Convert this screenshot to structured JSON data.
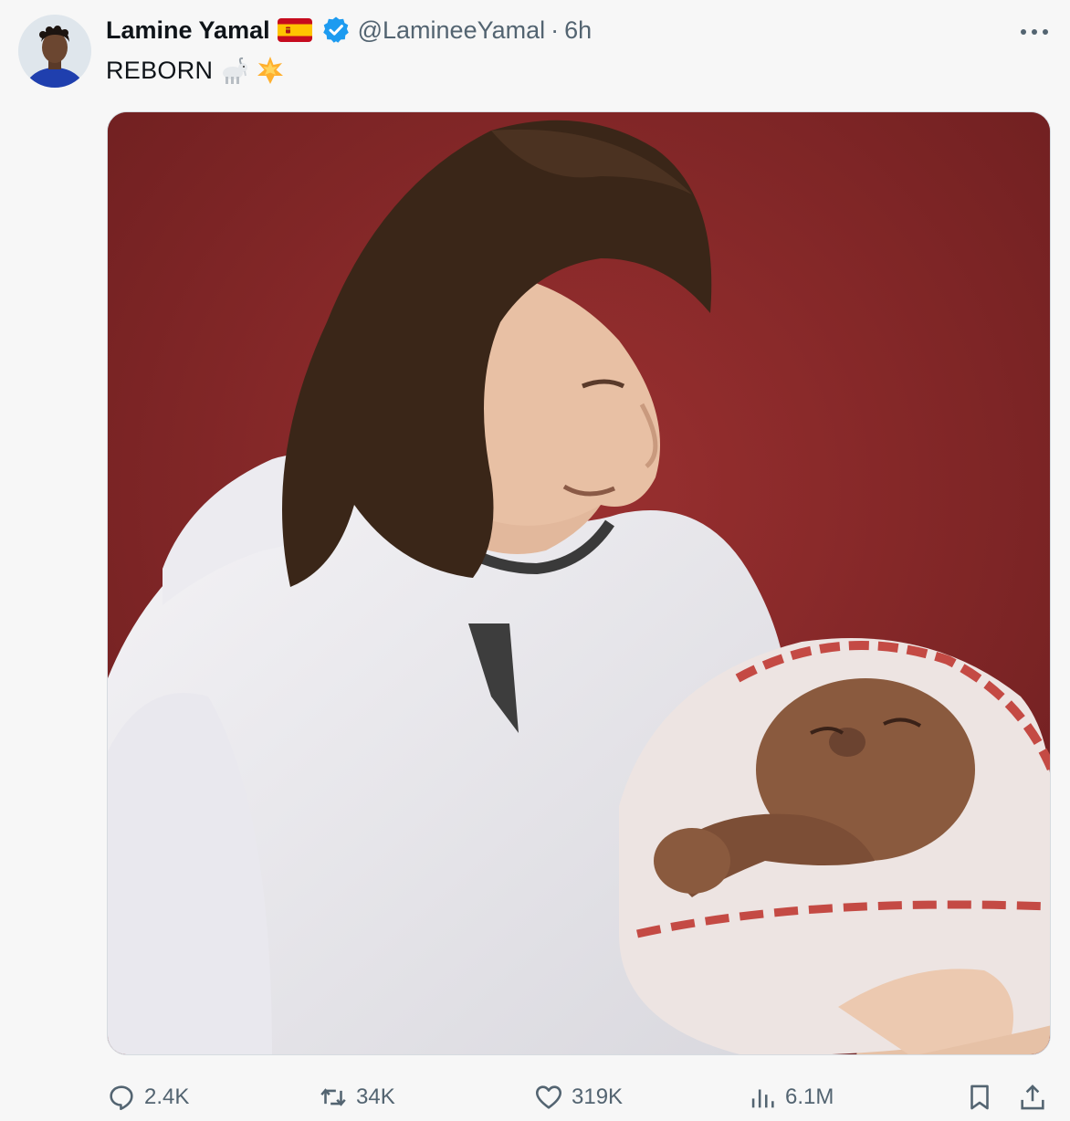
{
  "tweet": {
    "author": {
      "display_name": "Lamine Yamal",
      "handle": "@LamineeYamal",
      "verified": true,
      "flag": "spain-flag"
    },
    "separator": "·",
    "time": "6h",
    "text": "REBORN",
    "text_emojis": [
      "goat-emoji",
      "glowing-star-emoji"
    ],
    "media": {
      "kind": "photo",
      "background_color": "#7e2425"
    },
    "actions": {
      "replies": "2.4K",
      "reposts": "34K",
      "likes": "319K",
      "views": "6.1M"
    }
  },
  "colors": {
    "text_primary": "#0f1419",
    "text_secondary": "#536471",
    "verified_blue": "#1d9bf0",
    "background": "#f7f7f7"
  }
}
